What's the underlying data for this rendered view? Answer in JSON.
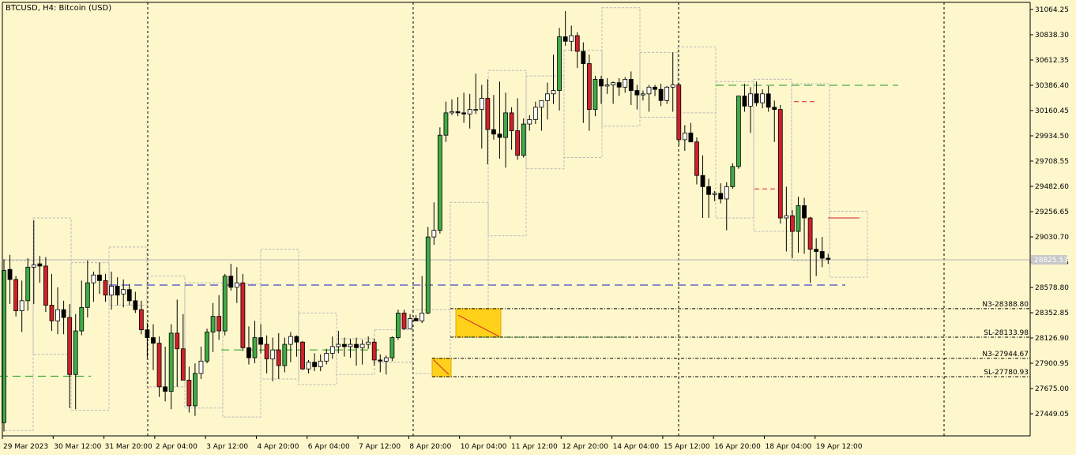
{
  "header": {
    "title": "BTCUSD, H4:  Bitcoin (USD)"
  },
  "current_price": "28825.53",
  "colors": {
    "background": "#fef7cc",
    "axis": "#000000",
    "bull": "#3fab46",
    "bear": "#d0202a",
    "doji_outline": "#000000",
    "box": "#b9b9b9",
    "zone": "#ffd11a",
    "blue_line": "#1b1bc9",
    "green_line": "#1e9c1e",
    "level_line": "#000000",
    "current_line": "#b4b4b4"
  },
  "chart_data": {
    "type": "candlestick",
    "title": "BTCUSD, H4:  Bitcoin (USD)",
    "ylim": [
      27280,
      31100
    ],
    "y_ticks": [
      "31064.25",
      "30838.30",
      "30612.35",
      "30386.40",
      "30160.45",
      "29934.50",
      "29708.55",
      "29482.60",
      "29256.65",
      "29030.70",
      "28804.75",
      "28578.80",
      "28352.85",
      "28126.90",
      "27900.95",
      "27675.00",
      "27449.05"
    ],
    "x_ticks": [
      "29 Mar 2023",
      "30 Mar 12:00",
      "31 Mar 20:00",
      "2 Apr 04:00",
      "3 Apr 12:00",
      "4 Apr 20:00",
      "6 Apr 04:00",
      "7 Apr 12:00",
      "8 Apr 20:00",
      "10 Apr 04:00",
      "11 Apr 12:00",
      "12 Apr 20:00",
      "14 Apr 04:00",
      "15 Apr 12:00",
      "16 Apr 20:00",
      "18 Apr 04:00",
      "19 Apr 12:00"
    ],
    "candles": [
      {
        "o": 27370,
        "h": 28830,
        "l": 27290,
        "c": 28730
      },
      {
        "o": 28740,
        "h": 28870,
        "l": 28430,
        "c": 28650
      },
      {
        "o": 28650,
        "h": 28680,
        "l": 28320,
        "c": 28370
      },
      {
        "o": 28370,
        "h": 28640,
        "l": 28180,
        "c": 28460
      },
      {
        "o": 28460,
        "h": 28840,
        "l": 28370,
        "c": 28760
      },
      {
        "o": 28760,
        "h": 29180,
        "l": 28430,
        "c": 28780
      },
      {
        "o": 28790,
        "h": 28860,
        "l": 28620,
        "c": 28770
      },
      {
        "o": 28770,
        "h": 28850,
        "l": 28360,
        "c": 28420
      },
      {
        "o": 28420,
        "h": 28700,
        "l": 28190,
        "c": 28280
      },
      {
        "o": 28280,
        "h": 28580,
        "l": 28160,
        "c": 28380
      },
      {
        "o": 28380,
        "h": 28460,
        "l": 28160,
        "c": 28310
      },
      {
        "o": 28310,
        "h": 28430,
        "l": 27500,
        "c": 27800
      },
      {
        "o": 27800,
        "h": 28340,
        "l": 27490,
        "c": 28190
      },
      {
        "o": 28190,
        "h": 28640,
        "l": 28150,
        "c": 28400
      },
      {
        "o": 28400,
        "h": 28820,
        "l": 28310,
        "c": 28620
      },
      {
        "o": 28620,
        "h": 28720,
        "l": 28450,
        "c": 28690
      },
      {
        "o": 28690,
        "h": 28800,
        "l": 28520,
        "c": 28640
      },
      {
        "o": 28640,
        "h": 28700,
        "l": 28450,
        "c": 28510
      },
      {
        "o": 28510,
        "h": 28720,
        "l": 28380,
        "c": 28590
      },
      {
        "o": 28590,
        "h": 28670,
        "l": 28420,
        "c": 28510
      },
      {
        "o": 28520,
        "h": 28650,
        "l": 28400,
        "c": 28560
      },
      {
        "o": 28560,
        "h": 28610,
        "l": 28420,
        "c": 28460
      },
      {
        "o": 28460,
        "h": 28540,
        "l": 28350,
        "c": 28380
      },
      {
        "o": 28380,
        "h": 28460,
        "l": 28160,
        "c": 28200
      },
      {
        "o": 28200,
        "h": 28260,
        "l": 27950,
        "c": 28130
      },
      {
        "o": 28130,
        "h": 28250,
        "l": 27840,
        "c": 28080
      },
      {
        "o": 28080,
        "h": 28140,
        "l": 27600,
        "c": 27690
      },
      {
        "o": 27690,
        "h": 28050,
        "l": 27560,
        "c": 27650
      },
      {
        "o": 27650,
        "h": 28250,
        "l": 27490,
        "c": 28170
      },
      {
        "o": 28170,
        "h": 28470,
        "l": 27690,
        "c": 28030
      },
      {
        "o": 28030,
        "h": 28340,
        "l": 27780,
        "c": 27750
      },
      {
        "o": 27750,
        "h": 27870,
        "l": 27460,
        "c": 27520
      },
      {
        "o": 27520,
        "h": 27900,
        "l": 27430,
        "c": 27810
      },
      {
        "o": 27810,
        "h": 28050,
        "l": 27760,
        "c": 27920
      },
      {
        "o": 27920,
        "h": 28210,
        "l": 27900,
        "c": 28180
      },
      {
        "o": 28180,
        "h": 28440,
        "l": 28000,
        "c": 28320
      },
      {
        "o": 28320,
        "h": 28510,
        "l": 28110,
        "c": 28190
      },
      {
        "o": 28190,
        "h": 28700,
        "l": 28150,
        "c": 28680
      },
      {
        "o": 28680,
        "h": 28790,
        "l": 28550,
        "c": 28580
      },
      {
        "o": 28580,
        "h": 28760,
        "l": 28440,
        "c": 28620
      },
      {
        "o": 28620,
        "h": 28700,
        "l": 28010,
        "c": 28040
      },
      {
        "o": 28040,
        "h": 28230,
        "l": 27890,
        "c": 27950
      },
      {
        "o": 27950,
        "h": 28280,
        "l": 27900,
        "c": 28130
      },
      {
        "o": 28130,
        "h": 28250,
        "l": 27990,
        "c": 28070
      },
      {
        "o": 28070,
        "h": 28150,
        "l": 27810,
        "c": 27940
      },
      {
        "o": 27940,
        "h": 28130,
        "l": 27740,
        "c": 28020
      },
      {
        "o": 28020,
        "h": 28170,
        "l": 27760,
        "c": 27880
      },
      {
        "o": 27880,
        "h": 28130,
        "l": 27820,
        "c": 28070
      },
      {
        "o": 28070,
        "h": 28180,
        "l": 27910,
        "c": 28140
      },
      {
        "o": 28140,
        "h": 28150,
        "l": 27960,
        "c": 28090
      },
      {
        "o": 28090,
        "h": 28100,
        "l": 27840,
        "c": 27850
      },
      {
        "o": 27850,
        "h": 27930,
        "l": 27810,
        "c": 27910
      },
      {
        "o": 27910,
        "h": 27990,
        "l": 27830,
        "c": 27870
      },
      {
        "o": 27870,
        "h": 27980,
        "l": 27830,
        "c": 27920
      },
      {
        "o": 27920,
        "h": 28030,
        "l": 27890,
        "c": 27990
      },
      {
        "o": 27990,
        "h": 28140,
        "l": 27940,
        "c": 28050
      },
      {
        "o": 28050,
        "h": 28190,
        "l": 27990,
        "c": 28070
      },
      {
        "o": 28070,
        "h": 28130,
        "l": 27960,
        "c": 28050
      },
      {
        "o": 28050,
        "h": 28120,
        "l": 27950,
        "c": 28070
      },
      {
        "o": 28070,
        "h": 28130,
        "l": 27880,
        "c": 28040
      },
      {
        "o": 28040,
        "h": 28110,
        "l": 27890,
        "c": 28070
      },
      {
        "o": 28070,
        "h": 28140,
        "l": 28030,
        "c": 28090
      },
      {
        "o": 28090,
        "h": 28120,
        "l": 27880,
        "c": 27930
      },
      {
        "o": 27930,
        "h": 27980,
        "l": 27820,
        "c": 27920
      },
      {
        "o": 27920,
        "h": 27970,
        "l": 27800,
        "c": 27950
      },
      {
        "o": 27950,
        "h": 28140,
        "l": 27920,
        "c": 28130
      },
      {
        "o": 28130,
        "h": 28380,
        "l": 28110,
        "c": 28350
      },
      {
        "o": 28350,
        "h": 28380,
        "l": 28200,
        "c": 28210
      },
      {
        "o": 28210,
        "h": 28340,
        "l": 28210,
        "c": 28300
      },
      {
        "o": 28300,
        "h": 28330,
        "l": 28280,
        "c": 28280
      },
      {
        "o": 28280,
        "h": 28680,
        "l": 28260,
        "c": 28350
      },
      {
        "o": 28350,
        "h": 29120,
        "l": 28340,
        "c": 29030
      },
      {
        "o": 29030,
        "h": 29340,
        "l": 28960,
        "c": 29090
      },
      {
        "o": 29090,
        "h": 30010,
        "l": 29060,
        "c": 29940
      },
      {
        "o": 29940,
        "h": 30240,
        "l": 29880,
        "c": 30140
      },
      {
        "o": 30140,
        "h": 30260,
        "l": 30120,
        "c": 30150
      },
      {
        "o": 30150,
        "h": 30280,
        "l": 30110,
        "c": 30140
      },
      {
        "o": 30140,
        "h": 30320,
        "l": 30050,
        "c": 30130
      },
      {
        "o": 30130,
        "h": 30310,
        "l": 30000,
        "c": 30170
      },
      {
        "o": 30170,
        "h": 30490,
        "l": 30130,
        "c": 30170
      },
      {
        "o": 30170,
        "h": 30390,
        "l": 29820,
        "c": 30270
      },
      {
        "o": 30270,
        "h": 30440,
        "l": 29680,
        "c": 29990
      },
      {
        "o": 29990,
        "h": 30300,
        "l": 29900,
        "c": 29950
      },
      {
        "o": 29950,
        "h": 30420,
        "l": 29730,
        "c": 29920
      },
      {
        "o": 29920,
        "h": 30320,
        "l": 29650,
        "c": 30140
      },
      {
        "o": 30140,
        "h": 30190,
        "l": 29810,
        "c": 29980
      },
      {
        "o": 29980,
        "h": 30270,
        "l": 29720,
        "c": 29760
      },
      {
        "o": 29760,
        "h": 30090,
        "l": 29740,
        "c": 30040
      },
      {
        "o": 30040,
        "h": 30120,
        "l": 29980,
        "c": 30080
      },
      {
        "o": 30080,
        "h": 30240,
        "l": 30040,
        "c": 30190
      },
      {
        "o": 30190,
        "h": 30240,
        "l": 29980,
        "c": 30250
      },
      {
        "o": 30250,
        "h": 30410,
        "l": 30080,
        "c": 30310
      },
      {
        "o": 30310,
        "h": 30660,
        "l": 30220,
        "c": 30340
      },
      {
        "o": 30340,
        "h": 30900,
        "l": 30160,
        "c": 30820
      },
      {
        "o": 30820,
        "h": 31050,
        "l": 30740,
        "c": 30780
      },
      {
        "o": 30780,
        "h": 30920,
        "l": 30690,
        "c": 30830
      },
      {
        "o": 30830,
        "h": 30860,
        "l": 30540,
        "c": 30690
      },
      {
        "o": 30690,
        "h": 30770,
        "l": 30050,
        "c": 30580
      },
      {
        "o": 30580,
        "h": 30660,
        "l": 29980,
        "c": 30170
      },
      {
        "o": 30170,
        "h": 30470,
        "l": 30110,
        "c": 30440
      },
      {
        "o": 30440,
        "h": 30470,
        "l": 30220,
        "c": 30380
      },
      {
        "o": 30380,
        "h": 30450,
        "l": 30310,
        "c": 30390
      },
      {
        "o": 30390,
        "h": 30420,
        "l": 30220,
        "c": 30410
      },
      {
        "o": 30410,
        "h": 30450,
        "l": 30290,
        "c": 30370
      },
      {
        "o": 30370,
        "h": 30460,
        "l": 30320,
        "c": 30440
      },
      {
        "o": 30440,
        "h": 30510,
        "l": 30210,
        "c": 30340
      },
      {
        "o": 30340,
        "h": 30390,
        "l": 30170,
        "c": 30300
      },
      {
        "o": 30300,
        "h": 30340,
        "l": 30250,
        "c": 30310
      },
      {
        "o": 30310,
        "h": 30390,
        "l": 30150,
        "c": 30370
      },
      {
        "o": 30370,
        "h": 30390,
        "l": 30290,
        "c": 30350
      },
      {
        "o": 30350,
        "h": 30400,
        "l": 30200,
        "c": 30250
      },
      {
        "o": 30250,
        "h": 30380,
        "l": 30220,
        "c": 30370
      },
      {
        "o": 30370,
        "h": 30680,
        "l": 30150,
        "c": 30390
      },
      {
        "o": 30390,
        "h": 30410,
        "l": 29850,
        "c": 29900
      },
      {
        "o": 29900,
        "h": 30030,
        "l": 29800,
        "c": 29960
      },
      {
        "o": 29960,
        "h": 30050,
        "l": 29920,
        "c": 29880
      },
      {
        "o": 29880,
        "h": 29920,
        "l": 29500,
        "c": 29580
      },
      {
        "o": 29580,
        "h": 29760,
        "l": 29200,
        "c": 29480
      },
      {
        "o": 29480,
        "h": 29550,
        "l": 29200,
        "c": 29410
      },
      {
        "o": 29410,
        "h": 29440,
        "l": 29350,
        "c": 29420
      },
      {
        "o": 29420,
        "h": 29510,
        "l": 29330,
        "c": 29370
      },
      {
        "o": 29370,
        "h": 29520,
        "l": 29090,
        "c": 29480
      },
      {
        "o": 29480,
        "h": 29690,
        "l": 29460,
        "c": 29660
      },
      {
        "o": 29660,
        "h": 30290,
        "l": 29640,
        "c": 30290
      },
      {
        "o": 30290,
        "h": 30400,
        "l": 30150,
        "c": 30200
      },
      {
        "o": 30200,
        "h": 30370,
        "l": 29960,
        "c": 30310
      },
      {
        "o": 30310,
        "h": 30420,
        "l": 30200,
        "c": 30230
      },
      {
        "o": 30230,
        "h": 30350,
        "l": 30180,
        "c": 30310
      },
      {
        "o": 30310,
        "h": 30380,
        "l": 30150,
        "c": 30190
      },
      {
        "o": 30190,
        "h": 30250,
        "l": 29880,
        "c": 30170
      },
      {
        "o": 30170,
        "h": 30210,
        "l": 29150,
        "c": 29200
      },
      {
        "o": 29200,
        "h": 29480,
        "l": 28900,
        "c": 29220
      },
      {
        "o": 29220,
        "h": 29270,
        "l": 28840,
        "c": 29080
      },
      {
        "o": 29080,
        "h": 29390,
        "l": 28890,
        "c": 29310
      },
      {
        "o": 29310,
        "h": 29380,
        "l": 28880,
        "c": 29200
      },
      {
        "o": 29200,
        "h": 29210,
        "l": 28620,
        "c": 28920
      },
      {
        "o": 28920,
        "h": 29020,
        "l": 28680,
        "c": 28900
      },
      {
        "o": 28900,
        "h": 29030,
        "l": 28760,
        "c": 28840
      },
      {
        "o": 28840,
        "h": 28880,
        "l": 28790,
        "c": 28830
      }
    ],
    "price_labels": [
      "N3-28388.80",
      "SL-28133.98",
      "N3-27944.67",
      "SL-27780.93"
    ]
  }
}
